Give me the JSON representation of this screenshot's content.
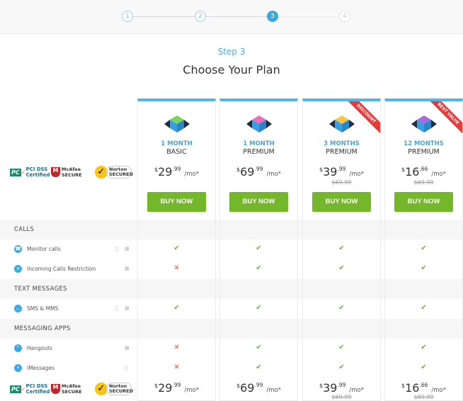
{
  "stepper": {
    "steps": [
      "1",
      "2",
      "3",
      "4"
    ],
    "active": 3
  },
  "header": {
    "step_label": "Step 3",
    "title": "Choose Your Plan"
  },
  "badges": {
    "pci": "PCI DSS Certified",
    "mcafee": "McAfee SECURE",
    "norton": "Norton SECURED"
  },
  "plans": [
    {
      "term": "1 MONTH",
      "tier": "BASIC",
      "currency": "$",
      "price": "29",
      "cents": ".99",
      "per": "/mo*",
      "old_price": "",
      "ribbon": "",
      "cube_top": "#7dd35a",
      "buy": "BUY NOW"
    },
    {
      "term": "1 MONTH",
      "tier": "PREMIUM",
      "currency": "$",
      "price": "69",
      "cents": ".99",
      "per": "/mo*",
      "old_price": "",
      "ribbon": "",
      "cube_top": "#e86fb8",
      "buy": "BUY NOW"
    },
    {
      "term": "3 MONTHS",
      "tier": "PREMIUM",
      "currency": "$",
      "price": "39",
      "cents": ".99",
      "per": "/mo*",
      "old_price": "$69.99",
      "ribbon": "DISCOUNT",
      "cube_top": "#f6c447",
      "buy": "BUY NOW"
    },
    {
      "term": "12 MONTHS",
      "tier": "PREMIUM",
      "currency": "$",
      "price": "16",
      "cents": ".66",
      "per": "/mo*",
      "old_price": "$69.99",
      "ribbon": "BEST VALUE",
      "cube_top": "#a56be0",
      "buy": "BUY NOW"
    }
  ],
  "features": [
    {
      "section": "CALLS"
    },
    {
      "label": "Monitor calls",
      "icon": "phone-icon",
      "platforms": [
        "apple",
        "android"
      ],
      "values": [
        true,
        true,
        true,
        true
      ]
    },
    {
      "label": "Incoming Calls Restriction",
      "icon": "block-icon",
      "platforms": [
        "android"
      ],
      "values": [
        false,
        true,
        true,
        true
      ]
    },
    {
      "section": "TEXT MESSAGES"
    },
    {
      "label": "SMS & MMS",
      "icon": "sms-icon",
      "platforms": [
        "apple",
        "android"
      ],
      "values": [
        true,
        true,
        true,
        true
      ]
    },
    {
      "section": "MESSAGING APPS"
    },
    {
      "label": "Hangouts",
      "icon": "hangouts-icon",
      "platforms": [
        "android"
      ],
      "values": [
        false,
        true,
        true,
        true
      ]
    },
    {
      "label": "iMessages",
      "icon": "imessage-icon",
      "platforms": [
        "apple"
      ],
      "values": [
        false,
        true,
        true,
        true
      ]
    }
  ],
  "colors": {
    "accent": "#3aa8e0",
    "buy": "#75b72b",
    "ribbon": "#e63b3b",
    "check": "#6cb33e",
    "cross": "#e05555"
  }
}
